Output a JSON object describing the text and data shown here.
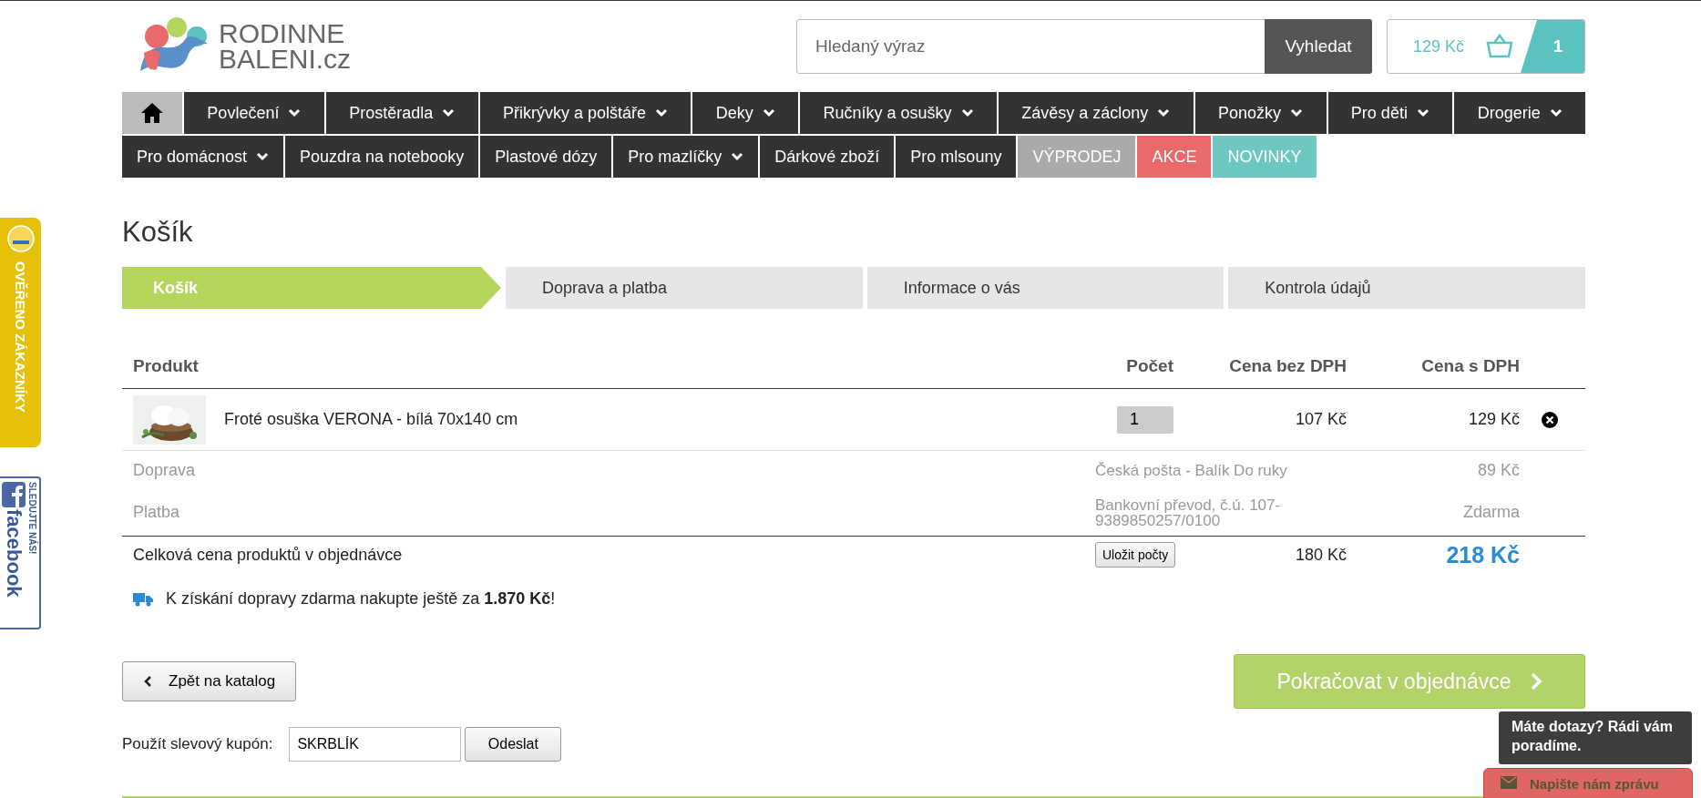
{
  "logo": {
    "line1": "RODINNE",
    "line2": "BALENI",
    "suffix": ".cz"
  },
  "search": {
    "placeholder": "Hledaný výraz",
    "button": "Vyhledat"
  },
  "cart": {
    "total": "129 Kč",
    "count": "1"
  },
  "nav_rows": [
    [
      {
        "kind": "home",
        "selected": true
      },
      {
        "kind": "link",
        "label": "Povlečení",
        "dropdown": true
      },
      {
        "kind": "link",
        "label": "Prostěradla",
        "dropdown": true
      },
      {
        "kind": "link",
        "label": "Přikrývky a polštáře",
        "dropdown": true
      },
      {
        "kind": "link",
        "label": "Deky",
        "dropdown": true
      },
      {
        "kind": "link",
        "label": "Ručníky a osušky",
        "dropdown": true
      },
      {
        "kind": "link",
        "label": "Závěsy a záclony",
        "dropdown": true
      },
      {
        "kind": "link",
        "label": "Ponožky",
        "dropdown": true
      },
      {
        "kind": "link",
        "label": "Pro děti",
        "dropdown": true
      },
      {
        "kind": "link",
        "label": "Drogerie",
        "dropdown": true
      }
    ],
    [
      {
        "kind": "link",
        "label": "Pro domácnost",
        "dropdown": true
      },
      {
        "kind": "link",
        "label": "Pouzdra na notebooky",
        "dropdown": false
      },
      {
        "kind": "link",
        "label": "Plastové dózy",
        "dropdown": false
      },
      {
        "kind": "link",
        "label": "Pro mazlíčky",
        "dropdown": true
      },
      {
        "kind": "link",
        "label": "Dárkové zboží",
        "dropdown": false
      },
      {
        "kind": "link",
        "label": "Pro mlsouny",
        "dropdown": false
      },
      {
        "kind": "sale",
        "label": "VÝPRODEJ",
        "dropdown": false
      },
      {
        "kind": "action",
        "label": "AKCE",
        "dropdown": false
      },
      {
        "kind": "new",
        "label": "NOVINKY",
        "dropdown": false
      }
    ]
  ],
  "side_badges": [
    {
      "kind": "verified",
      "label": "OVĚŘENO ZÁKAZNÍKY"
    },
    {
      "kind": "facebook",
      "label": "facebook",
      "sublabel": "SLEDUJTE NÁS!"
    }
  ],
  "page_title": "Košík",
  "steps": [
    {
      "label": "Košík",
      "selected": true
    },
    {
      "label": "Doprava a platba",
      "selected": false
    },
    {
      "label": "Informace o vás",
      "selected": false
    },
    {
      "label": "Kontrola údajů",
      "selected": false
    }
  ],
  "table": {
    "columns": [
      "Produkt",
      "Počet",
      "Cena bez DPH",
      "Cena s DPH"
    ],
    "items": [
      {
        "name": "Froté osuška VERONA - bílá 70x140 cm",
        "quantity": "1",
        "price_net": "107 Kč",
        "price_gross": "129 Kč"
      }
    ],
    "extras": [
      {
        "label": "Doprava",
        "value": "Česká pošta - Balík Do ruky",
        "price": "89 Kč"
      },
      {
        "label": "Platba",
        "value": "Bankovní převod, č.ú. 107-9389850257/0100",
        "price": "Zdarma"
      }
    ],
    "total": {
      "label": "Celková cena produktů v objednávce",
      "button": "Uložit počty",
      "price_net": "180 Kč",
      "price_gross": "218 Kč"
    }
  },
  "free_shipping_note": "K získání dopravy zdarma nakupte ještě za **1.870 Kč**!",
  "back_button": "Zpět na katalog",
  "continue_button": "Pokračovat v objednávce",
  "coupon": {
    "label": "Použít slevový kupón:",
    "value": "SKRBLÍK",
    "button": "Odeslat"
  },
  "chat": {
    "tooltip": "Máte dotazy? Rádi vám poradíme.",
    "button": "Napište nám zprávu"
  }
}
